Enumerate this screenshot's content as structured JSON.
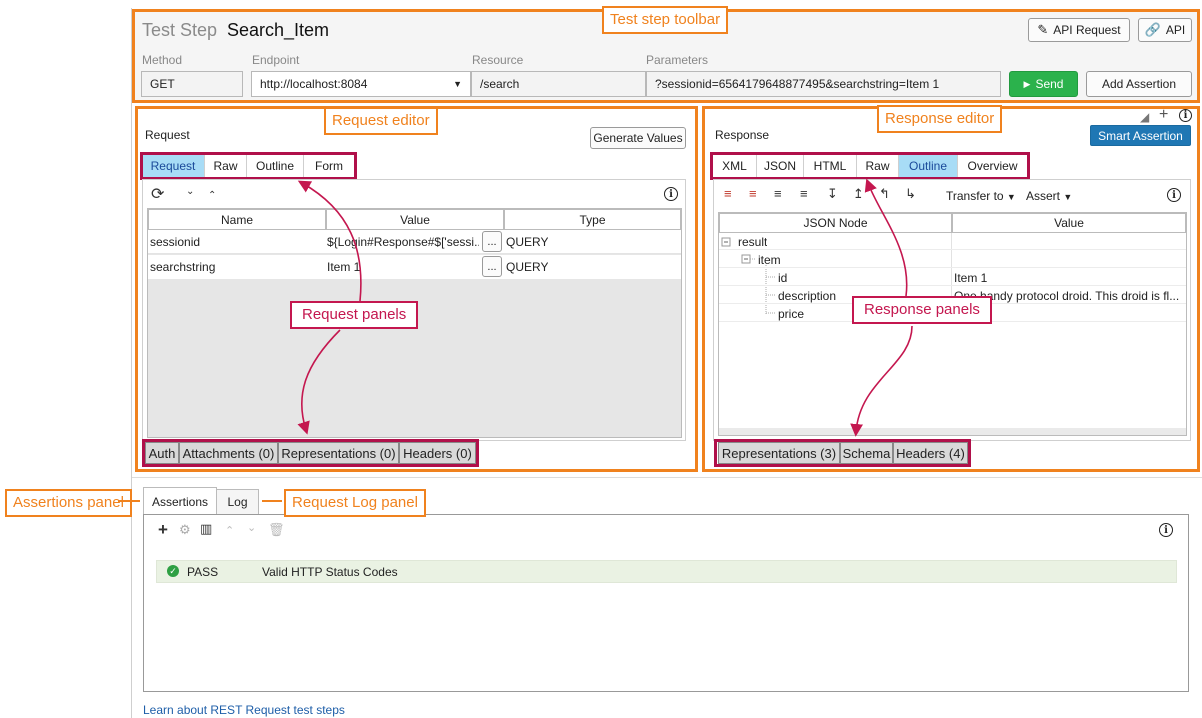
{
  "toolbar": {
    "prefix": "Test Step",
    "name": "Search_Item",
    "api_request_label": "API Request",
    "api_label": "API",
    "method_label": "Method",
    "endpoint_label": "Endpoint",
    "resource_label": "Resource",
    "parameters_label": "Parameters",
    "method_value": "GET",
    "endpoint_value": "http://localhost:8084",
    "resource_value": "/search",
    "parameters_value": "?sessionid=6564179648877495&searchstring=Item 1",
    "send_label": "Send",
    "add_assertion_label": "Add Assertion"
  },
  "request": {
    "title": "Request",
    "generate_values_label": "Generate Values",
    "tabs": [
      "Request",
      "Raw",
      "Outline",
      "Form"
    ],
    "columns": [
      "Name",
      "Value",
      "Type"
    ],
    "rows": [
      {
        "name": "sessionid",
        "value": "${Login#Response#$['sessi...",
        "type": "QUERY"
      },
      {
        "name": "searchstring",
        "value": "Item 1",
        "type": "QUERY"
      }
    ],
    "bottom_tabs": [
      "Auth",
      "Attachments (0)",
      "Representations (0)",
      "Headers (0)"
    ]
  },
  "response": {
    "title": "Response",
    "smart_assertion_label": "Smart Assertion",
    "tabs": [
      "XML",
      "JSON",
      "HTML",
      "Raw",
      "Outline",
      "Overview"
    ],
    "transfer_to_label": "Transfer to",
    "assert_label": "Assert",
    "columns": [
      "JSON Node",
      "Value"
    ],
    "tree": [
      {
        "node": "result",
        "value": ""
      },
      {
        "node": "item",
        "value": ""
      },
      {
        "node": "id",
        "value": "Item 1"
      },
      {
        "node": "description",
        "value": "One handy protocol droid. This droid is fl..."
      },
      {
        "node": "price",
        "value": ""
      }
    ],
    "bottom_tabs": [
      "Representations (3)",
      "Schema",
      "Headers (4)"
    ]
  },
  "assertions": {
    "tabs": [
      "Assertions",
      "Log"
    ],
    "rows": [
      {
        "status": "PASS",
        "name": "Valid HTTP Status Codes"
      }
    ],
    "learn_link": "Learn about REST Request test steps"
  },
  "callouts": {
    "toolbar": "Test step toolbar",
    "request_editor": "Request editor",
    "response_editor": "Response editor",
    "request_panels": "Request panels",
    "response_panels": "Response panels",
    "assertions_panel": "Assertions panel",
    "request_log_panel": "Request Log panel"
  },
  "colors": {
    "callout_orange": "#f0821e",
    "callout_red": "#c4174f",
    "tab_active": "#a8dcf6",
    "send_green": "#2bb24c",
    "smart_assertion_blue": "#1f77b4",
    "pass_green": "#2ea043"
  }
}
